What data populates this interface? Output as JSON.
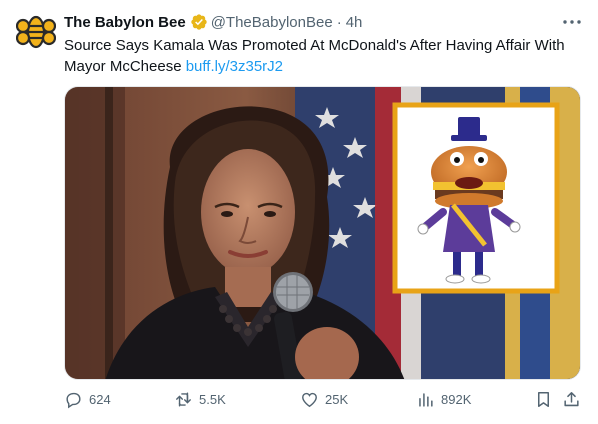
{
  "tweet": {
    "author_name": "The Babylon Bee",
    "handle": "@TheBabylonBee",
    "separator": "·",
    "time": "4h",
    "text": "Source Says Kamala Was Promoted At McDonald's After Having Affair With Mayor McCheese",
    "link_text": "buff.ly/3z35rJ2"
  },
  "actions": {
    "replies": "624",
    "retweets": "5.5K",
    "likes": "25K",
    "views": "892K"
  },
  "colors": {
    "link": "#1d9bf0",
    "secondary_text": "#536471",
    "verified_badge": "#e8b619",
    "logo": "#f2b21b"
  },
  "icons": [
    "babylon-bee-logo",
    "verified-badge-icon",
    "more-icon",
    "reply-icon",
    "retweet-icon",
    "like-icon",
    "views-icon",
    "bookmark-icon",
    "share-icon"
  ]
}
